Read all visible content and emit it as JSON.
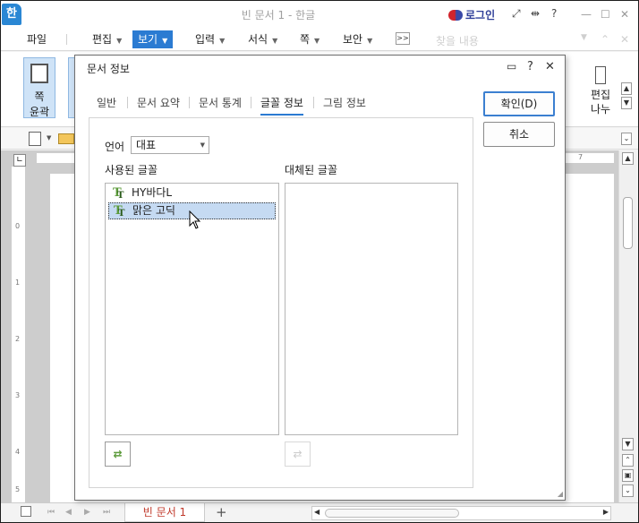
{
  "app": {
    "logo": "한",
    "title": "빈 문서 1 - 한글",
    "login": "로그인",
    "accent": "#2b7bd2"
  },
  "menu": {
    "items": [
      {
        "label": "파일"
      },
      {
        "label": "편집"
      },
      {
        "label": "보기"
      },
      {
        "label": "입력"
      },
      {
        "label": "서식"
      },
      {
        "label": "쪽"
      },
      {
        "label": "보안"
      }
    ],
    "faded_label": "찾을 내용"
  },
  "ribbon": {
    "left_button": "쪽\n윤곽",
    "left_button_line1": "쪽",
    "left_button_line2": "윤곽",
    "right_button_line1": "편집",
    "right_button_line2": "나누"
  },
  "ruler": {
    "h_number": "7",
    "v_numbers": [
      "0",
      "1",
      "2",
      "3",
      "4",
      "5"
    ]
  },
  "statusbar": {
    "doc_tab": "빈 문서 1",
    "add_tab": "+"
  },
  "dialog": {
    "title": "문서 정보",
    "tabs": [
      {
        "label": "일반"
      },
      {
        "label": "문서 요약"
      },
      {
        "label": "문서 통계"
      },
      {
        "label": "글꼴 정보",
        "active": true
      },
      {
        "label": "그림 정보"
      }
    ],
    "language_label": "언어",
    "language_value": "대표",
    "used_fonts_label": "사용된 글꼴",
    "substituted_fonts_label": "대체된 글꼴",
    "used_fonts": [
      {
        "name": "HY바다L",
        "selected": false
      },
      {
        "name": "맑은 고딕",
        "selected": true
      }
    ],
    "substituted_fonts": [],
    "ok_label": "확인(D)",
    "cancel_label": "취소"
  }
}
